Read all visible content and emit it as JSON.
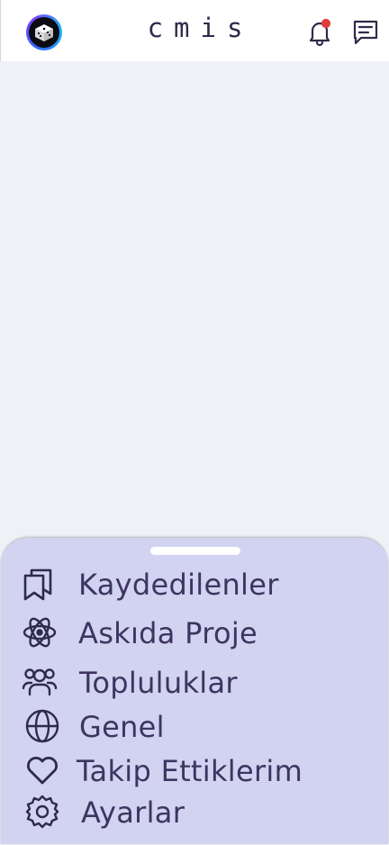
{
  "header": {
    "app_title": "cmis",
    "avatar_icon": "dice-cube-icon",
    "notification_icon": "bell-icon",
    "messages_icon": "chat-icon",
    "notification_dot_color": "#e23b3b"
  },
  "menu": {
    "items": [
      {
        "label": "Kaydedilenler",
        "icon": "bookmark-icon"
      },
      {
        "label": "Askıda Proje",
        "icon": "atom-icon"
      },
      {
        "label": "Topluluklar",
        "icon": "users-icon"
      },
      {
        "label": "Genel",
        "icon": "globe-icon"
      },
      {
        "label": "Takip Ettiklerim",
        "icon": "heart-icon"
      },
      {
        "label": "Ayarlar",
        "icon": "gear-icon"
      }
    ]
  },
  "colors": {
    "sheet_background": "#d1d3f1",
    "text": "#3d3560",
    "page_background": "#eff1f6"
  }
}
